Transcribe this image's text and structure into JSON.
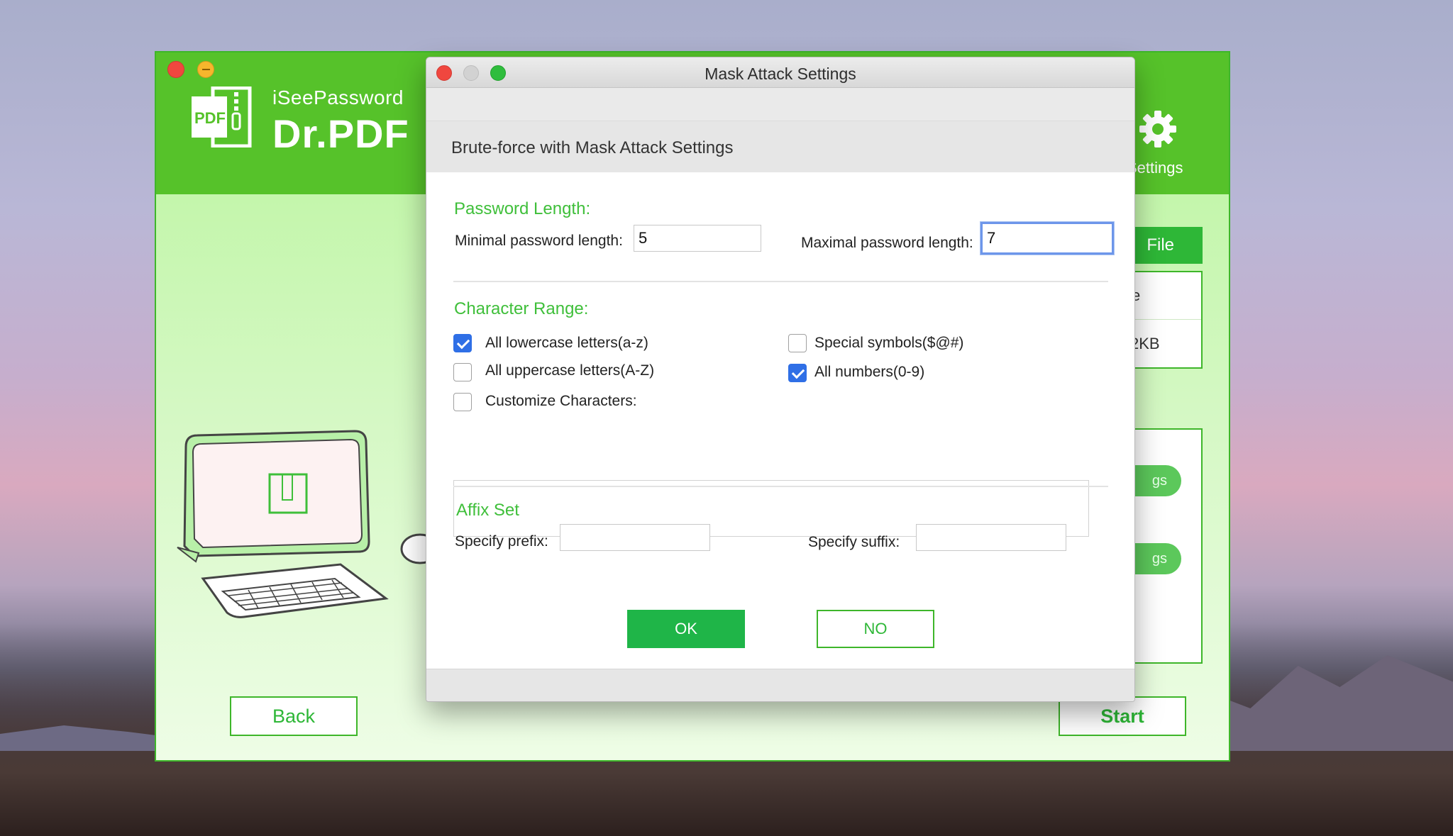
{
  "app": {
    "brand_small": "iSeePassword",
    "brand_big": "Dr.PDF",
    "logo_text": "PDF",
    "settings_label": "Settings",
    "add_file_label": "File",
    "file_cell_1": "e",
    "file_cell_2": "2KB",
    "option_btn_1": "gs",
    "option_btn_2": "gs",
    "back_label": "Back",
    "start_label": "Start"
  },
  "dialog": {
    "title": "Mask Attack Settings",
    "subtitle": "Brute-force with Mask Attack Settings",
    "password_length": {
      "section_title": "Password Length:",
      "min_label": "Minimal password length:",
      "min_value": "5",
      "max_label": "Maximal password length:",
      "max_value": "7"
    },
    "character_range": {
      "section_title": "Character Range:",
      "options": [
        {
          "label": "All lowercase letters(a-z)",
          "checked": true
        },
        {
          "label": "Special symbols($@#)",
          "checked": false
        },
        {
          "label": "All uppercase letters(A-Z)",
          "checked": false
        },
        {
          "label": "All numbers(0-9)",
          "checked": true
        },
        {
          "label": "Customize Characters:",
          "checked": false
        }
      ],
      "custom_value": ""
    },
    "affix": {
      "section_title": "Affix Set",
      "prefix_label": "Specify prefix:",
      "prefix_value": "",
      "suffix_label": "Specify suffix:",
      "suffix_value": ""
    },
    "ok_label": "OK",
    "no_label": "NO"
  },
  "colors": {
    "brand_green": "#56c22a",
    "accent_green": "#3fbf3a",
    "checkbox_blue": "#2f6fe6",
    "focus_blue": "#6d96ea"
  }
}
